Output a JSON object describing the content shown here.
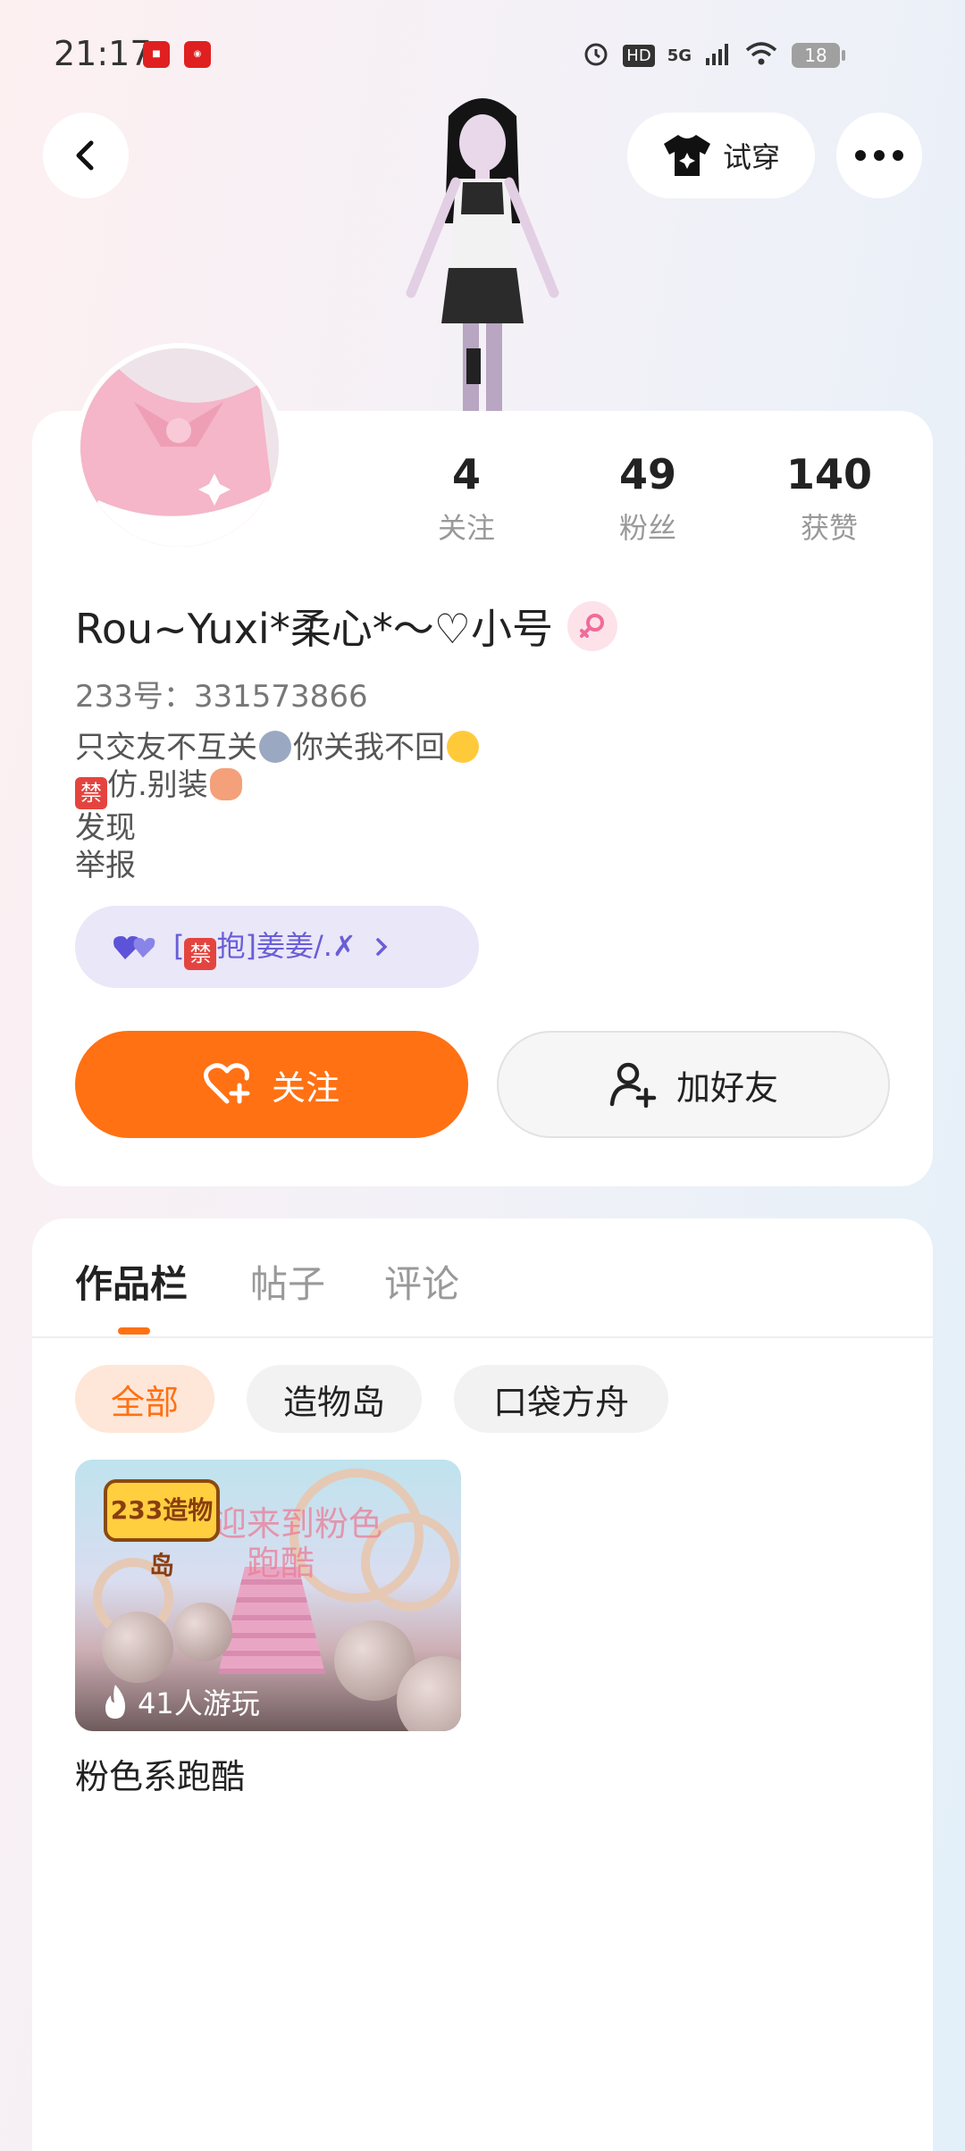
{
  "status_bar": {
    "time": "21:17",
    "battery": "18",
    "network": "5G",
    "hd": "HD"
  },
  "topbar": {
    "try_on_label": "试穿"
  },
  "stats": [
    {
      "value": "4",
      "label": "关注"
    },
    {
      "value": "49",
      "label": "粉丝"
    },
    {
      "value": "140",
      "label": "获赞"
    }
  ],
  "profile": {
    "nickname": "Rou~Yuxi*柔心*～♡小号",
    "uid": "233号：331573866",
    "bio_line1_a": "只交友不互关",
    "bio_line1_b": "你关我不回",
    "bio_line2_ban": "禁",
    "bio_line2_text": "仿.别装",
    "bio_line3": "发现",
    "bio_line4": "举报",
    "pill_prefix": "[",
    "pill_ban": "禁",
    "pill_text": "抱]姜姜/.✗"
  },
  "actions": {
    "follow_label": "关注",
    "add_friend_label": "加好友"
  },
  "tabs": [
    "作品栏",
    "帖子",
    "评论"
  ],
  "filters": [
    "全部",
    "造物岛",
    "口袋方舟"
  ],
  "works": [
    {
      "title": "粉色系跑酷",
      "plays": "41人游玩",
      "cover_sign": "欢迎来到粉色跑酷",
      "cover_logo": "233造物岛"
    }
  ],
  "colors": {
    "accent": "#ff7113",
    "pill_text": "#6a5ed6"
  }
}
